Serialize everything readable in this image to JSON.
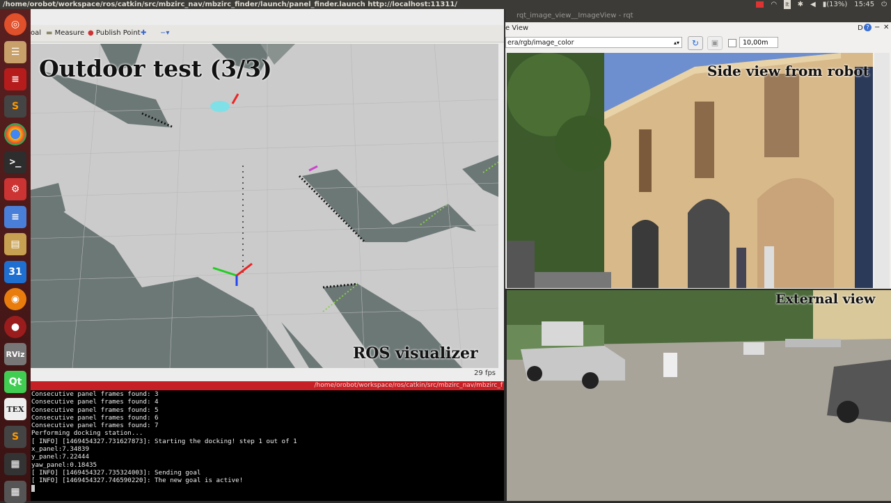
{
  "topbar": {
    "title": "/home/orobot/workspace/ros/catkin/src/mbzirc_nav/mbzirc_finder/launch/panel_finder.launch http://localhost:11311/",
    "battery": "(13%)",
    "clock": "15:45",
    "lang": "It"
  },
  "launcher": {
    "calendar_day": "31",
    "rviz_label": "RViz",
    "tex_label": "TEX"
  },
  "rviz": {
    "toolbar": {
      "goal_fragment": "oal",
      "measure": "Measure",
      "publish_point": "Publish Point"
    },
    "caption_top": "Outdoor test (3/3)",
    "caption_bottom": "ROS visualizer",
    "fps": "29 fps"
  },
  "terminal": {
    "title": "/home/orobot/workspace/ros/catkin/src/mbzirc_nav/mbzirc_f",
    "lines": [
      "Consecutive panel frames found: 3",
      "Consecutive panel frames found: 4",
      "Consecutive panel frames found: 5",
      "Consecutive panel frames found: 6",
      "Consecutive panel frames found: 7",
      "Performing docking station...",
      "[ INFO] [1469454327.731627873]: Starting the docking! step 1 out of 1",
      "x_panel:7.34839",
      "y_panel:7.22444",
      "yaw_panel:0.18435",
      "[ INFO] [1469454327.735324003]: Sending goal",
      "[ INFO] [1469454327.746590220]: The new goal is active!"
    ]
  },
  "rqt": {
    "window_title": "rqt_image_view__ImageView - rqt",
    "menu_label": "e View",
    "topic": "era/rgb/image_color",
    "zoom_value": "10,00m",
    "caption": "Side view from robot",
    "menu_icons": "D"
  },
  "external": {
    "caption": "External view"
  }
}
